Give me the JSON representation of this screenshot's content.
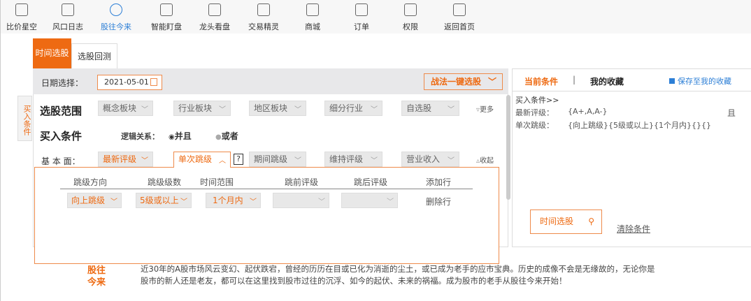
{
  "nav": [
    {
      "label": "比价星空",
      "icon": "chart-icon"
    },
    {
      "label": "风口日志",
      "icon": "notebook-icon"
    },
    {
      "label": "股往今来",
      "icon": "cube-icon",
      "active": true
    },
    {
      "label": "智能盯盘",
      "icon": "monitor-icon"
    },
    {
      "label": "龙头看盘",
      "icon": "dragon-icon"
    },
    {
      "label": "交易精灵",
      "icon": "robot-icon"
    },
    {
      "label": "商城",
      "icon": "store-icon"
    },
    {
      "label": "订单",
      "icon": "document-icon"
    },
    {
      "label": "权限",
      "icon": "shield-key-icon"
    },
    {
      "label": "返回首页",
      "icon": "home-icon"
    }
  ],
  "tabs": [
    "时间选股",
    "选股回测"
  ],
  "date": {
    "label": "日期选择：",
    "value": "2021-05-01"
  },
  "strategy_button": "战法一键选股",
  "side_tab": "买入条件",
  "scope": {
    "title": "选股范围",
    "dropdowns": [
      "概念板块",
      "行业板块",
      "地区板块",
      "细分行业",
      "自选股"
    ],
    "more": "更多"
  },
  "buy": {
    "title": "买入条件",
    "logic_label": "逻辑关系：",
    "options": [
      "并且",
      "或者"
    ],
    "selected": "并且"
  },
  "fundamental": {
    "label": "基 本 面：",
    "dropdowns": [
      "最新评级",
      "单次跳级",
      "期间跳级",
      "维持评级",
      "营业收入"
    ],
    "help": "?",
    "collapse": "收起"
  },
  "popup": {
    "headers": [
      "跳级方向",
      "跳级级数",
      "时间范围",
      "跳前评级",
      "跳后评级",
      "添加行"
    ],
    "row": [
      "向上跳级",
      "5级或以上",
      "1个月内",
      "",
      ""
    ],
    "delete": "删除行"
  },
  "right": {
    "tab_current": "当前条件",
    "sep": "|",
    "tab_fav": "我的收藏",
    "save": "保存至我的收藏",
    "heading": "买入条件>>",
    "lines": [
      {
        "k": "最新评级：",
        "v": "{A+,A,A-}",
        "c": "且"
      },
      {
        "k": "单次跳级：",
        "v": "{向上跳级}{5级或以上}{1个月内}{}{}"
      }
    ],
    "search_button": "时间选股",
    "clear": "清除条件"
  },
  "footer": {
    "brand1": "股往",
    "brand2": "今来",
    "line1": "近30年的A股市场风云变幻、起伏跌宕，曾经的历历在目或已化为消逝的尘土，或已成为老手的应市宝典。历史的成像不会是无缘故的，无论你是",
    "line2": "股市的新人还是老友，都可以在这里找到股市过往的沉浮、如今的起伏、未来的祸福。成为股市的老手从股往今来开始！"
  },
  "colors": {
    "accent": "#ee6a12",
    "link": "#2d7fd6"
  }
}
